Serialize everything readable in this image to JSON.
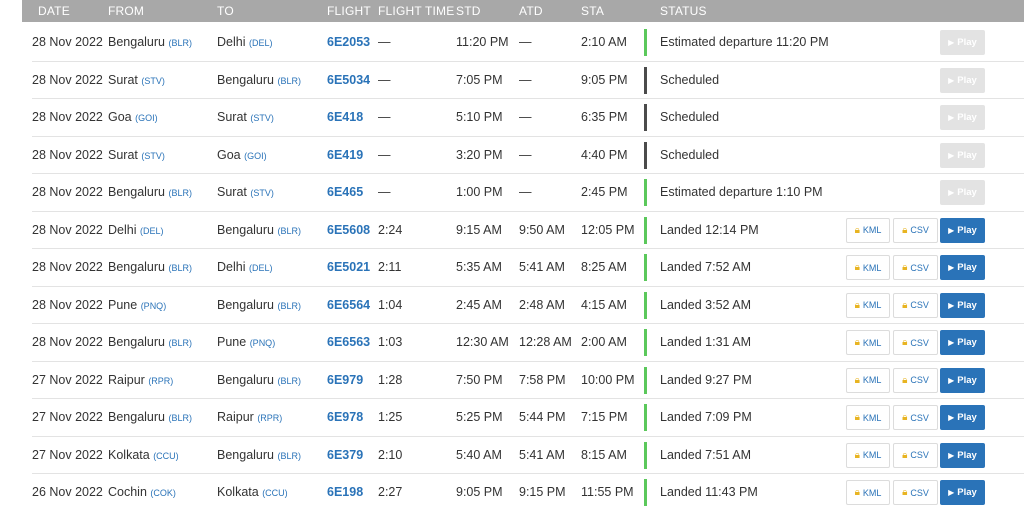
{
  "headers": {
    "date": "DATE",
    "from": "FROM",
    "to": "TO",
    "flight": "FLIGHT",
    "flight_time": "FLIGHT TIME",
    "std": "STD",
    "atd": "ATD",
    "sta": "STA",
    "status": "STATUS"
  },
  "buttons": {
    "kml": "KML",
    "csv": "CSV",
    "play": "Play"
  },
  "icons": {
    "lock": "lock-icon",
    "play": "play-triangle-icon"
  },
  "colors": {
    "link": "#2a73b8",
    "status_green": "#5bc85b",
    "status_gray": "#4b4b4b",
    "header_bg": "#a8a8a8",
    "lock": "#e8b421"
  },
  "rows": [
    {
      "date": "28 Nov 2022",
      "from_city": "Bengaluru",
      "from_code": "(BLR)",
      "to_city": "Delhi",
      "to_code": "(DEL)",
      "flight": "6E2053",
      "flight_time": "—",
      "std": "11:20 PM",
      "atd": "—",
      "sta": "2:10 AM",
      "status": "Estimated departure 11:20 PM",
      "status_color": "green",
      "landed": false
    },
    {
      "date": "28 Nov 2022",
      "from_city": "Surat",
      "from_code": "(STV)",
      "to_city": "Bengaluru",
      "to_code": "(BLR)",
      "flight": "6E5034",
      "flight_time": "—",
      "std": "7:05 PM",
      "atd": "—",
      "sta": "9:05 PM",
      "status": "Scheduled",
      "status_color": "gray",
      "landed": false
    },
    {
      "date": "28 Nov 2022",
      "from_city": "Goa",
      "from_code": "(GOI)",
      "to_city": "Surat",
      "to_code": "(STV)",
      "flight": "6E418",
      "flight_time": "—",
      "std": "5:10 PM",
      "atd": "—",
      "sta": "6:35 PM",
      "status": "Scheduled",
      "status_color": "gray",
      "landed": false
    },
    {
      "date": "28 Nov 2022",
      "from_city": "Surat",
      "from_code": "(STV)",
      "to_city": "Goa",
      "to_code": "(GOI)",
      "flight": "6E419",
      "flight_time": "—",
      "std": "3:20 PM",
      "atd": "—",
      "sta": "4:40 PM",
      "status": "Scheduled",
      "status_color": "gray",
      "landed": false
    },
    {
      "date": "28 Nov 2022",
      "from_city": "Bengaluru",
      "from_code": "(BLR)",
      "to_city": "Surat",
      "to_code": "(STV)",
      "flight": "6E465",
      "flight_time": "—",
      "std": "1:00 PM",
      "atd": "—",
      "sta": "2:45 PM",
      "status": "Estimated departure 1:10 PM",
      "status_color": "green",
      "landed": false
    },
    {
      "date": "28 Nov 2022",
      "from_city": "Delhi",
      "from_code": "(DEL)",
      "to_city": "Bengaluru",
      "to_code": "(BLR)",
      "flight": "6E5608",
      "flight_time": "2:24",
      "std": "9:15 AM",
      "atd": "9:50 AM",
      "sta": "12:05 PM",
      "status": "Landed 12:14 PM",
      "status_color": "green",
      "landed": true
    },
    {
      "date": "28 Nov 2022",
      "from_city": "Bengaluru",
      "from_code": "(BLR)",
      "to_city": "Delhi",
      "to_code": "(DEL)",
      "flight": "6E5021",
      "flight_time": "2:11",
      "std": "5:35 AM",
      "atd": "5:41 AM",
      "sta": "8:25 AM",
      "status": "Landed 7:52 AM",
      "status_color": "green",
      "landed": true
    },
    {
      "date": "28 Nov 2022",
      "from_city": "Pune",
      "from_code": "(PNQ)",
      "to_city": "Bengaluru",
      "to_code": "(BLR)",
      "flight": "6E6564",
      "flight_time": "1:04",
      "std": "2:45 AM",
      "atd": "2:48 AM",
      "sta": "4:15 AM",
      "status": "Landed 3:52 AM",
      "status_color": "green",
      "landed": true
    },
    {
      "date": "28 Nov 2022",
      "from_city": "Bengaluru",
      "from_code": "(BLR)",
      "to_city": "Pune",
      "to_code": "(PNQ)",
      "flight": "6E6563",
      "flight_time": "1:03",
      "std": "12:30 AM",
      "atd": "12:28 AM",
      "sta": "2:00 AM",
      "status": "Landed 1:31 AM",
      "status_color": "green",
      "landed": true
    },
    {
      "date": "27 Nov 2022",
      "from_city": "Raipur",
      "from_code": "(RPR)",
      "to_city": "Bengaluru",
      "to_code": "(BLR)",
      "flight": "6E979",
      "flight_time": "1:28",
      "std": "7:50 PM",
      "atd": "7:58 PM",
      "sta": "10:00 PM",
      "status": "Landed 9:27 PM",
      "status_color": "green",
      "landed": true
    },
    {
      "date": "27 Nov 2022",
      "from_city": "Bengaluru",
      "from_code": "(BLR)",
      "to_city": "Raipur",
      "to_code": "(RPR)",
      "flight": "6E978",
      "flight_time": "1:25",
      "std": "5:25 PM",
      "atd": "5:44 PM",
      "sta": "7:15 PM",
      "status": "Landed 7:09 PM",
      "status_color": "green",
      "landed": true
    },
    {
      "date": "27 Nov 2022",
      "from_city": "Kolkata",
      "from_code": "(CCU)",
      "to_city": "Bengaluru",
      "to_code": "(BLR)",
      "flight": "6E379",
      "flight_time": "2:10",
      "std": "5:40 AM",
      "atd": "5:41 AM",
      "sta": "8:15 AM",
      "status": "Landed 7:51 AM",
      "status_color": "green",
      "landed": true
    },
    {
      "date": "26 Nov 2022",
      "from_city": "Cochin",
      "from_code": "(COK)",
      "to_city": "Kolkata",
      "to_code": "(CCU)",
      "flight": "6E198",
      "flight_time": "2:27",
      "std": "9:05 PM",
      "atd": "9:15 PM",
      "sta": "11:55 PM",
      "status": "Landed 11:43 PM",
      "status_color": "green",
      "landed": true
    }
  ]
}
